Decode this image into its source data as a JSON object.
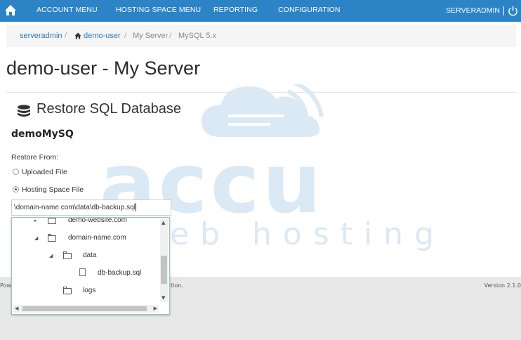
{
  "nav": {
    "items": [
      "ACCOUNT MENU",
      "HOSTING SPACE MENU",
      "REPORTING",
      "CONFIGURATION"
    ],
    "user": "SERVERADMIN",
    "separator": "|"
  },
  "breadcrumb": {
    "items": [
      "serveradmin",
      "demo-user",
      "My Server",
      "MySQL 5.x"
    ],
    "sep": "/"
  },
  "page": {
    "title": "demo-user - My Server"
  },
  "section": {
    "title": "Restore SQL Database",
    "db_name": "demoMySQ"
  },
  "form": {
    "restore_from_label": "Restore From:",
    "option_uploaded": "Uploaded File",
    "option_hosting": "Hosting Space File",
    "selected": "hosting",
    "path_value": "\\domain-name.com\\data\\db-backup.sql"
  },
  "tree": {
    "nodes": [
      {
        "label": "demo-website.com",
        "type": "folder",
        "level": 0,
        "expanded": false
      },
      {
        "label": "domain-name.com",
        "type": "folder",
        "level": 0,
        "expanded": true
      },
      {
        "label": "data",
        "type": "folder",
        "level": 1,
        "expanded": true
      },
      {
        "label": "db-backup.sql",
        "type": "file",
        "level": 2
      },
      {
        "label": "logs",
        "type": "folder",
        "level": 1,
        "expanded": false
      }
    ]
  },
  "footer": {
    "left": "Pow",
    "mid": "tion.",
    "version": "Version 2.1.0"
  },
  "watermark": {
    "word1": "accu",
    "word2": "web hosting"
  },
  "colors": {
    "brand": "#2c83c6",
    "link": "#2a7ab8",
    "watermark": "#c7dff0"
  }
}
